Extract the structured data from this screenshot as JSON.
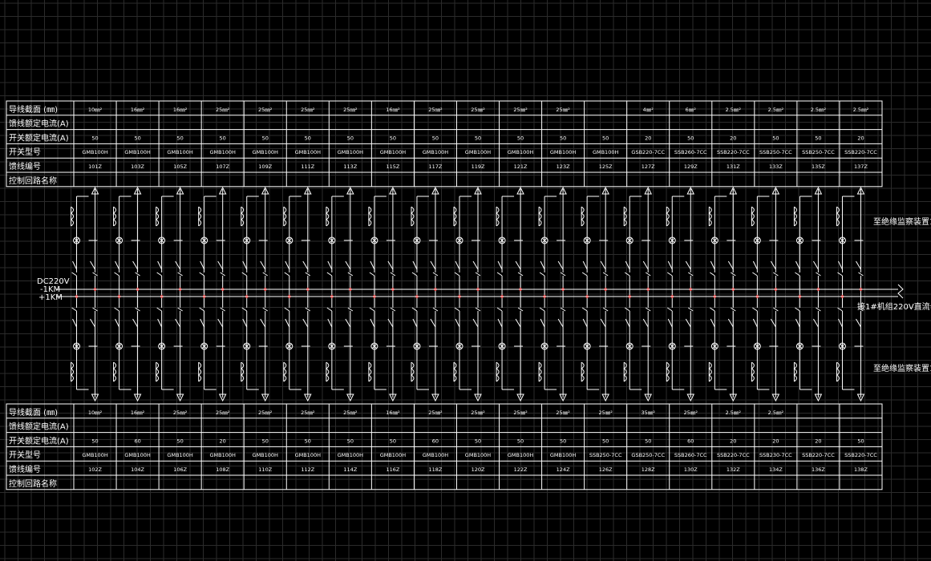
{
  "diagram": {
    "bus": {
      "source_label": "DC220V",
      "negative_label": "-1KM",
      "positive_label": "+1KM",
      "bus_name": "接1#机组220V直流母线"
    },
    "top_output_label": "至绝缘监察装置1",
    "bottom_output_label": "至绝缘监察装置1",
    "top_table": {
      "row_headers": [
        "导线截面 (㎜)",
        "馈线额定电流(A)",
        "开关额定电流(A)",
        "开关型号",
        "馈线编号",
        "控制回路名称"
      ],
      "cross_sections": [
        "10㎜²",
        "16㎜²",
        "16㎜²",
        "25㎜²",
        "25㎜²",
        "25㎜²",
        "25㎜²",
        "16㎜²",
        "25㎜²",
        "25㎜²",
        "25㎜²",
        "25㎜²",
        "",
        "4㎜²",
        "6㎜²",
        "2.5㎜²",
        "2.5㎜²",
        "2.5㎜²",
        "2.5㎜²"
      ],
      "feeder_currents": [
        "",
        "",
        "",
        "",
        "",
        "",
        "",
        "",
        "",
        "",
        "",
        "",
        "",
        "",
        "",
        "",
        "",
        "",
        ""
      ],
      "switch_currents": [
        "50",
        "50",
        "50",
        "50",
        "50",
        "50",
        "50",
        "50",
        "50",
        "50",
        "50",
        "50",
        "50",
        "20",
        "50",
        "20",
        "50",
        "50",
        "20"
      ],
      "switch_models": [
        "GMB100H",
        "GMB100H",
        "GMB100H",
        "GMB100H",
        "GMB100H",
        "GMB100H",
        "GMB100H",
        "GMB100H",
        "GMB100H",
        "GMB100H",
        "GMB100H",
        "GMB100H",
        "GMB100H",
        "GSB220-7CC",
        "SSB260-7CC",
        "SSB220-7CC",
        "SSB250-7CC",
        "SSB250-7CC",
        "SSB220-7CC"
      ],
      "feeder_ids": [
        "101Z",
        "103Z",
        "105Z",
        "107Z",
        "109Z",
        "111Z",
        "113Z",
        "115Z",
        "117Z",
        "119Z",
        "121Z",
        "123Z",
        "125Z",
        "127Z",
        "129Z",
        "131Z",
        "133Z",
        "135Z",
        "137Z"
      ],
      "loop_names": [
        "",
        "",
        "",
        "",
        "",
        "",
        "",
        "",
        "",
        "",
        "",
        "",
        "",
        "",
        "",
        "",
        "",
        "",
        ""
      ]
    },
    "bottom_table": {
      "row_headers": [
        "导线截面 (㎜)",
        "馈线额定电流(A)",
        "开关额定电流(A)",
        "开关型号",
        "馈线编号",
        "控制回路名称"
      ],
      "cross_sections": [
        "10㎜²",
        "16㎜²",
        "25㎜²",
        "25㎜²",
        "25㎜²",
        "25㎜²",
        "25㎜²",
        "16㎜²",
        "25㎜²",
        "25㎜²",
        "25㎜²",
        "25㎜²",
        "25㎜²",
        "35㎜²",
        "25㎜²",
        "2.5㎜²",
        "2.5㎜²",
        "",
        ""
      ],
      "feeder_currents": [
        "",
        "",
        "",
        "",
        "",
        "",
        "",
        "",
        "",
        "",
        "",
        "",
        "",
        "",
        "",
        "",
        "",
        "",
        ""
      ],
      "switch_currents": [
        "50",
        "60",
        "50",
        "20",
        "50",
        "50",
        "50",
        "50",
        "60",
        "50",
        "50",
        "50",
        "50",
        "50",
        "60",
        "20",
        "20",
        "20",
        "50"
      ],
      "switch_models": [
        "GMB100H",
        "GMB100H",
        "GMB100H",
        "GMB100H",
        "GMB100H",
        "GMB100H",
        "GMB100H",
        "GMB100H",
        "GMB100H",
        "GMB100H",
        "GMB100H",
        "GMB100H",
        "SSB250-7CC",
        "GSB250-7CC",
        "SSB260-7CC",
        "SSB220-7CC",
        "SSB230-7CC",
        "SSB220-7CC",
        "SSB220-7CC"
      ],
      "feeder_ids": [
        "102Z",
        "104Z",
        "106Z",
        "108Z",
        "110Z",
        "112Z",
        "114Z",
        "116Z",
        "118Z",
        "120Z",
        "122Z",
        "124Z",
        "126Z",
        "128Z",
        "130Z",
        "132Z",
        "134Z",
        "136Z",
        "138Z"
      ],
      "loop_names": [
        "",
        "",
        "",
        "",
        "",
        "",
        "",
        "",
        "",
        "",
        "",
        "",
        "",
        "",
        "",
        "",
        "",
        "",
        ""
      ]
    },
    "colors": {
      "background": "#000000",
      "grid": "#2b2b2b",
      "lines": "#ffffff",
      "junction": "#ff2020"
    }
  }
}
